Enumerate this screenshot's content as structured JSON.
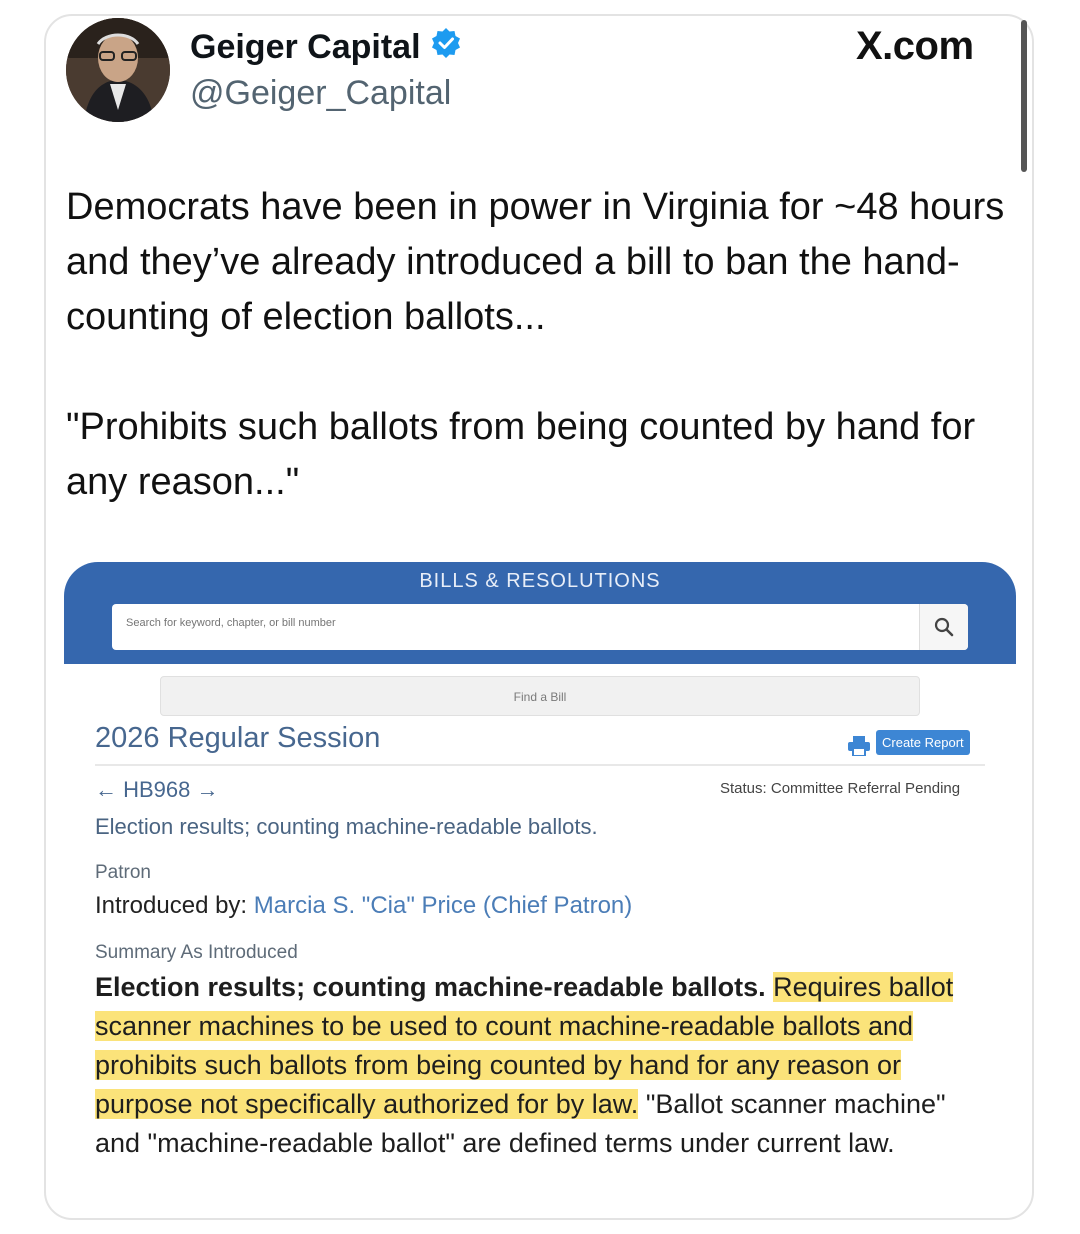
{
  "tweet": {
    "author_name": "Geiger Capital",
    "handle": "@Geiger_Capital",
    "site": "X.com",
    "paragraphs": [
      "Democrats have been in power in Virginia for ~48 hours and they’ve already introduced a bill to ban the hand-counting of election ballots...",
      "\"Prohibits such ballots from being counted by hand for any reason...\""
    ]
  },
  "bill_page": {
    "banner_title": "BILLS & RESOLUTIONS",
    "search_placeholder": "Search for keyword, chapter, or bill number",
    "find_bill": "Find a Bill",
    "session": "2026 Regular Session",
    "create_report": "Create Report",
    "bill_number": "HB968",
    "status": "Status: Committee Referral Pending",
    "bill_title": "Election results; counting machine-readable ballots.",
    "patron_label": "Patron",
    "introduced_by_label": "Introduced by:",
    "patron_name": "Marcia S. \"Cia\" Price (Chief Patron)",
    "summary_label": "Summary As Introduced",
    "summary_bold": "Election results; counting machine-readable ballots.",
    "summary_highlight": "Requires ballot scanner machines to be used to count machine-readable ballots and prohibits such ballots from being counted by hand for any reason or purpose not specifically authorized for by law.",
    "summary_rest": "\"Ballot scanner machine\" and \"machine-readable ballot\" are defined terms under current law."
  },
  "colors": {
    "banner": "#3567ae",
    "highlight": "#fbe37a",
    "verified": "#1d9bf0",
    "link": "#4b7db7"
  },
  "icons": [
    "verified-badge-icon",
    "search-icon",
    "printer-icon",
    "arrow-left-icon",
    "arrow-right-icon"
  ]
}
